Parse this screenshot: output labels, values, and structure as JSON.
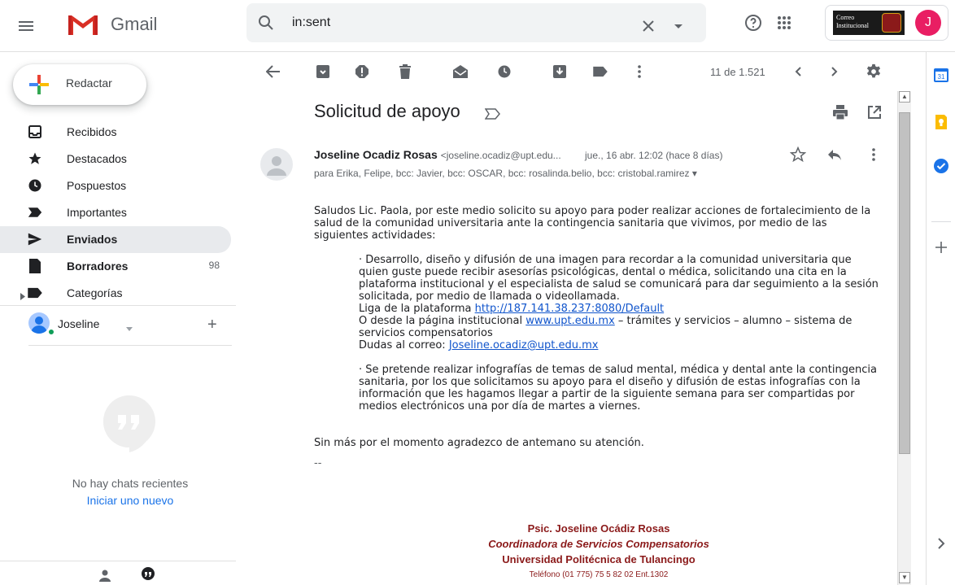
{
  "app": {
    "name": "Gmail"
  },
  "header": {
    "search_value": "in:sent",
    "account_logo_text": "Correo Institucional",
    "avatar_letter": "J"
  },
  "sidebar": {
    "compose_label": "Redactar",
    "items": [
      {
        "label": "Recibidos",
        "icon": "inbox-icon"
      },
      {
        "label": "Destacados",
        "icon": "star-icon"
      },
      {
        "label": "Pospuestos",
        "icon": "clock-icon"
      },
      {
        "label": "Importantes",
        "icon": "label-important-icon"
      },
      {
        "label": "Enviados",
        "icon": "send-icon",
        "active": true
      },
      {
        "label": "Borradores",
        "icon": "draft-icon",
        "count": "98"
      },
      {
        "label": "Categorías",
        "icon": "label-icon"
      }
    ],
    "hangouts_user": "Joseline",
    "no_chats": "No hay chats recientes",
    "start_new": "Iniciar uno nuevo"
  },
  "toolbar": {
    "count": "11 de 1.521"
  },
  "message": {
    "subject": "Solicitud de apoyo",
    "sender_name": "Joseline Ocadiz Rosas",
    "sender_email": "<joseline.ocadiz@upt.edu...",
    "date": "jue., 16 abr. 12:02 (hace 8 días)",
    "recipients": "para Erika, Felipe, bcc: Javier, bcc: OSCAR, bcc: rosalinda.belio, bcc: cristobal.ramirez ▾",
    "body": {
      "intro": "Saludos Lic. Paola, por este medio solicito su apoyo para poder realizar acciones de fortalecimiento de la salud de la comunidad universitaria ante la contingencia sanitaria que vivimos, por medio de las siguientes actividades:",
      "bullet1": "·        Desarrollo, diseño y difusión de una imagen para recordar a la comunidad universitaria que quien guste puede recibir asesorías psicológicas, dental o médica, solicitando una cita en la plataforma institucional y el especialista de salud se comunicará para dar seguimiento a la sesión solicitada, por medio de llamada o videollamada.",
      "liga_label": "Liga de la plataforma ",
      "liga_url": "http://187.141.38.237:8080/Default",
      "pagina_label": "O desde la página institucional ",
      "pagina_url": "www.upt.edu.mx",
      "pagina_rest": " – trámites y servicios – alumno – sistema de servicios compensatorios",
      "dudas_label": "Dudas al correo: ",
      "dudas_email": "Joseline.ocadiz@upt.edu.mx",
      "bullet2": "·        Se pretende realizar infografías de temas de salud mental, médica y dental ante la contingencia sanitaria, por los que solicitamos su apoyo para el diseño y difusión de estas infografías con la información que les hagamos llegar a partir de la siguiente semana para ser compartidas por medios electrónicos una por día de martes a viernes.",
      "closing": "Sin más por el momento agradezco de antemano su atención.",
      "dashes": "--"
    },
    "signature": {
      "name": "Psic. Joseline Ocádiz Rosas",
      "title": "Coordinadora de Servicios Compensatorios",
      "org": "Universidad Politécnica de Tulancingo",
      "phone": "Teléfono (01 775) 75 5 82 02 Ent.1302"
    }
  },
  "side_panel": {
    "calendar_day": "31"
  },
  "colors": {
    "accent": "#1a73e8",
    "active_bg": "#e8eaed",
    "signature": "#8b1a1a",
    "avatar": "#e91e63"
  }
}
